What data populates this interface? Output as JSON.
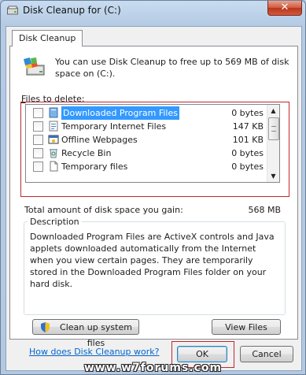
{
  "window": {
    "title": "Disk Cleanup for  (C:)",
    "close_glyph": "✕"
  },
  "tab": {
    "label": "Disk Cleanup"
  },
  "intro": {
    "text": "You can use Disk Cleanup to free up to 569 MB of disk space on  (C:)."
  },
  "files": {
    "label_accel": "F",
    "label_rest": "iles to delete:",
    "items": [
      {
        "name": "Downloaded Program Files",
        "size": "0 bytes",
        "icon": "folder-icon",
        "selected": true,
        "checked": false
      },
      {
        "name": "Temporary Internet Files",
        "size": "147 KB",
        "icon": "document-icon",
        "selected": false,
        "checked": false
      },
      {
        "name": "Offline Webpages",
        "size": "101 KB",
        "icon": "webpage-icon",
        "selected": false,
        "checked": false
      },
      {
        "name": "Recycle Bin",
        "size": "0 bytes",
        "icon": "recycle-bin-icon",
        "selected": false,
        "checked": false
      },
      {
        "name": "Temporary files",
        "size": "0 bytes",
        "icon": "blank-file-icon",
        "selected": false,
        "checked": false
      }
    ]
  },
  "total": {
    "label": "Total amount of disk space you gain:",
    "value": "568 MB"
  },
  "description": {
    "title": "Description",
    "text": "Downloaded Program Files are ActiveX controls and Java applets downloaded automatically from the Internet when you view certain pages. They are temporarily stored in the Downloaded Program Files folder on your hard disk."
  },
  "buttons": {
    "cleanup_system": "Clean up system files",
    "view_files": "View Files",
    "ok": "OK",
    "cancel": "Cancel"
  },
  "link": {
    "how": "How does Disk Cleanup work?"
  },
  "watermark": {
    "text": "www.w7forums.com"
  },
  "colors": {
    "selection": "#3399ff",
    "highlight_frame": "#c0282e",
    "link": "#0066cc"
  }
}
